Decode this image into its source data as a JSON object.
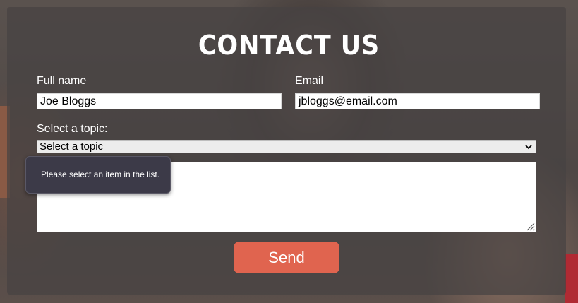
{
  "form": {
    "title": "CONTACT US",
    "full_name_label": "Full name",
    "full_name_value": "Joe Bloggs",
    "email_label": "Email",
    "email_value": "jbloggs@email.com",
    "topic_label": "Select a topic:",
    "topic_selected": "Select a topic",
    "message_value": "",
    "send_label": "Send"
  },
  "tooltip": {
    "text": "Please select an item in the list."
  },
  "icons": {
    "select_arrow": "chevron-down-icon",
    "resize_handle": "resize-grip-icon"
  },
  "colors": {
    "send_button": "#e0644f",
    "tooltip_bg": "#3c3a48",
    "panel_overlay": "rgba(70,66,66,0.72)"
  }
}
